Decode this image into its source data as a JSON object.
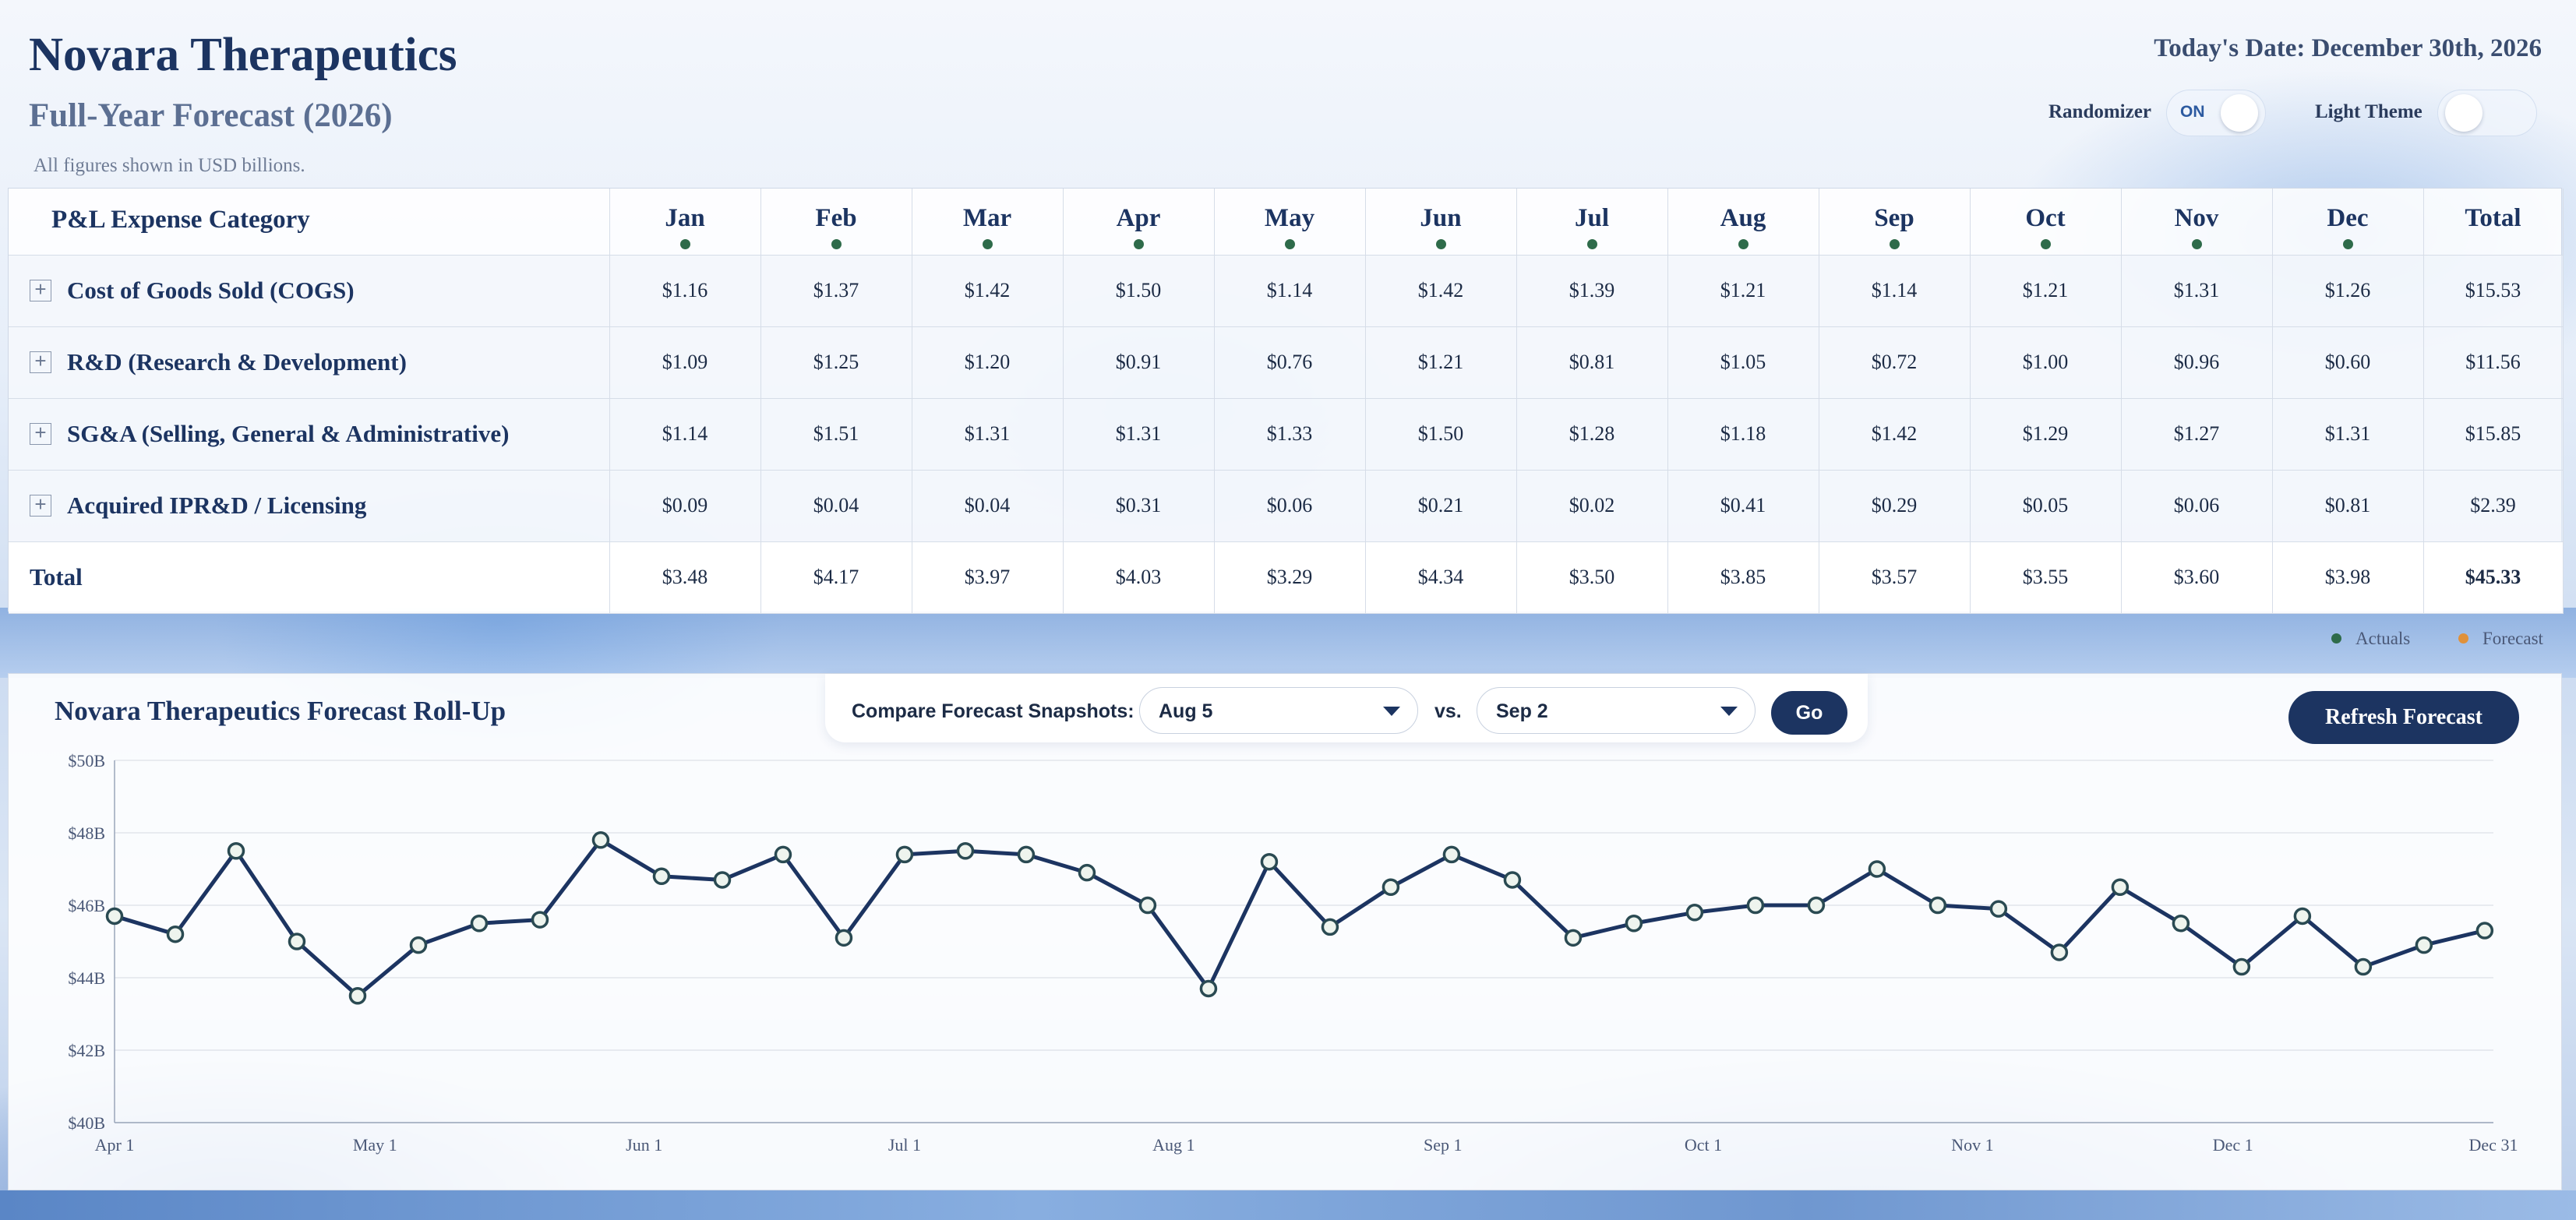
{
  "header": {
    "company": "Novara Therapeutics",
    "subtitle": "Full-Year Forecast (2026)",
    "note": "All figures shown in USD billions.",
    "today": "Today's Date: December 30th, 2026"
  },
  "controls": {
    "randomizer_label": "Randomizer",
    "randomizer_state": "ON",
    "theme_label": "Light Theme"
  },
  "table": {
    "category_header": "P&L Expense Category",
    "months": [
      "Jan",
      "Feb",
      "Mar",
      "Apr",
      "May",
      "Jun",
      "Jul",
      "Aug",
      "Sep",
      "Oct",
      "Nov",
      "Dec"
    ],
    "total_header": "Total",
    "rows": [
      {
        "label": "Cost of Goods Sold (COGS)",
        "values": [
          "$1.16",
          "$1.37",
          "$1.42",
          "$1.50",
          "$1.14",
          "$1.42",
          "$1.39",
          "$1.21",
          "$1.14",
          "$1.21",
          "$1.31",
          "$1.26"
        ],
        "total": "$15.53"
      },
      {
        "label": "R&D (Research & Development)",
        "values": [
          "$1.09",
          "$1.25",
          "$1.20",
          "$0.91",
          "$0.76",
          "$1.21",
          "$0.81",
          "$1.05",
          "$0.72",
          "$1.00",
          "$0.96",
          "$0.60"
        ],
        "total": "$11.56"
      },
      {
        "label": "SG&A (Selling, General & Administrative)",
        "values": [
          "$1.14",
          "$1.51",
          "$1.31",
          "$1.31",
          "$1.33",
          "$1.50",
          "$1.28",
          "$1.18",
          "$1.42",
          "$1.29",
          "$1.27",
          "$1.31"
        ],
        "total": "$15.85"
      },
      {
        "label": "Acquired IPR&D / Licensing",
        "values": [
          "$0.09",
          "$0.04",
          "$0.04",
          "$0.31",
          "$0.06",
          "$0.21",
          "$0.02",
          "$0.41",
          "$0.29",
          "$0.05",
          "$0.06",
          "$0.81"
        ],
        "total": "$2.39"
      }
    ],
    "total_row": {
      "label": "Total",
      "values": [
        "$3.48",
        "$4.17",
        "$3.97",
        "$4.03",
        "$3.29",
        "$4.34",
        "$3.50",
        "$3.85",
        "$3.57",
        "$3.55",
        "$3.60",
        "$3.98"
      ],
      "total": "$45.33"
    }
  },
  "legend": {
    "actuals_label": "Actuals",
    "forecast_label": "Forecast",
    "actuals_color": "#2e6b4a",
    "forecast_color": "#e0913a"
  },
  "rollup": {
    "title": "Novara Therapeutics Forecast Roll-Up",
    "compare_label": "Compare Forecast Snapshots:",
    "snapshot_a": "Aug 5",
    "vs_label": "vs.",
    "snapshot_b": "Sep 2",
    "go_label": "Go",
    "refresh_label": "Refresh Forecast"
  },
  "chart_data": {
    "type": "line",
    "title": "Novara Therapeutics Forecast Roll-Up",
    "xlabel": "",
    "ylabel": "",
    "x_range": [
      "2026-04-01",
      "2026-12-31"
    ],
    "ylim": [
      40,
      50
    ],
    "y_ticks": [
      {
        "value": 40,
        "label": "$40B"
      },
      {
        "value": 42,
        "label": "$42B"
      },
      {
        "value": 44,
        "label": "$44B"
      },
      {
        "value": 46,
        "label": "$46B"
      },
      {
        "value": 48,
        "label": "$48B"
      },
      {
        "value": 50,
        "label": "$50B"
      }
    ],
    "x_ticks": [
      {
        "date": "2026-04-01",
        "label": "Apr 1"
      },
      {
        "date": "2026-05-01",
        "label": "May 1"
      },
      {
        "date": "2026-06-01",
        "label": "Jun 1"
      },
      {
        "date": "2026-07-01",
        "label": "Jul 1"
      },
      {
        "date": "2026-08-01",
        "label": "Aug 1"
      },
      {
        "date": "2026-09-01",
        "label": "Sep 1"
      },
      {
        "date": "2026-10-01",
        "label": "Oct 1"
      },
      {
        "date": "2026-11-01",
        "label": "Nov 1"
      },
      {
        "date": "2026-12-01",
        "label": "Dec 1"
      },
      {
        "date": "2026-12-31",
        "label": "Dec 31"
      }
    ],
    "grid": true,
    "series": [
      {
        "color": "#1c3461",
        "points": [
          {
            "x": "2026-04-01",
            "y": 45.7
          },
          {
            "x": "2026-04-08",
            "y": 45.2
          },
          {
            "x": "2026-04-15",
            "y": 47.5
          },
          {
            "x": "2026-04-22",
            "y": 45.0
          },
          {
            "x": "2026-04-29",
            "y": 43.5
          },
          {
            "x": "2026-05-06",
            "y": 44.9
          },
          {
            "x": "2026-05-13",
            "y": 45.5
          },
          {
            "x": "2026-05-20",
            "y": 45.6
          },
          {
            "x": "2026-05-27",
            "y": 47.8
          },
          {
            "x": "2026-06-03",
            "y": 46.8
          },
          {
            "x": "2026-06-10",
            "y": 46.7
          },
          {
            "x": "2026-06-17",
            "y": 47.4
          },
          {
            "x": "2026-06-24",
            "y": 45.1
          },
          {
            "x": "2026-07-01",
            "y": 47.4
          },
          {
            "x": "2026-07-08",
            "y": 47.5
          },
          {
            "x": "2026-07-15",
            "y": 47.4
          },
          {
            "x": "2026-07-22",
            "y": 46.9
          },
          {
            "x": "2026-07-29",
            "y": 46.0
          },
          {
            "x": "2026-08-05",
            "y": 43.7
          },
          {
            "x": "2026-08-12",
            "y": 47.2
          },
          {
            "x": "2026-08-19",
            "y": 45.4
          },
          {
            "x": "2026-08-26",
            "y": 46.5
          },
          {
            "x": "2026-09-02",
            "y": 47.4
          },
          {
            "x": "2026-09-09",
            "y": 46.7
          },
          {
            "x": "2026-09-16",
            "y": 45.1
          },
          {
            "x": "2026-09-23",
            "y": 45.5
          },
          {
            "x": "2026-09-30",
            "y": 45.8
          },
          {
            "x": "2026-10-07",
            "y": 46.0
          },
          {
            "x": "2026-10-14",
            "y": 46.0
          },
          {
            "x": "2026-10-21",
            "y": 47.0
          },
          {
            "x": "2026-10-28",
            "y": 46.0
          },
          {
            "x": "2026-11-04",
            "y": 45.9
          },
          {
            "x": "2026-11-11",
            "y": 44.7
          },
          {
            "x": "2026-11-18",
            "y": 46.5
          },
          {
            "x": "2026-11-25",
            "y": 45.5
          },
          {
            "x": "2026-12-02",
            "y": 44.3
          },
          {
            "x": "2026-12-09",
            "y": 45.7
          },
          {
            "x": "2026-12-16",
            "y": 44.3
          },
          {
            "x": "2026-12-23",
            "y": 44.9
          },
          {
            "x": "2026-12-30",
            "y": 45.3
          }
        ]
      }
    ]
  }
}
